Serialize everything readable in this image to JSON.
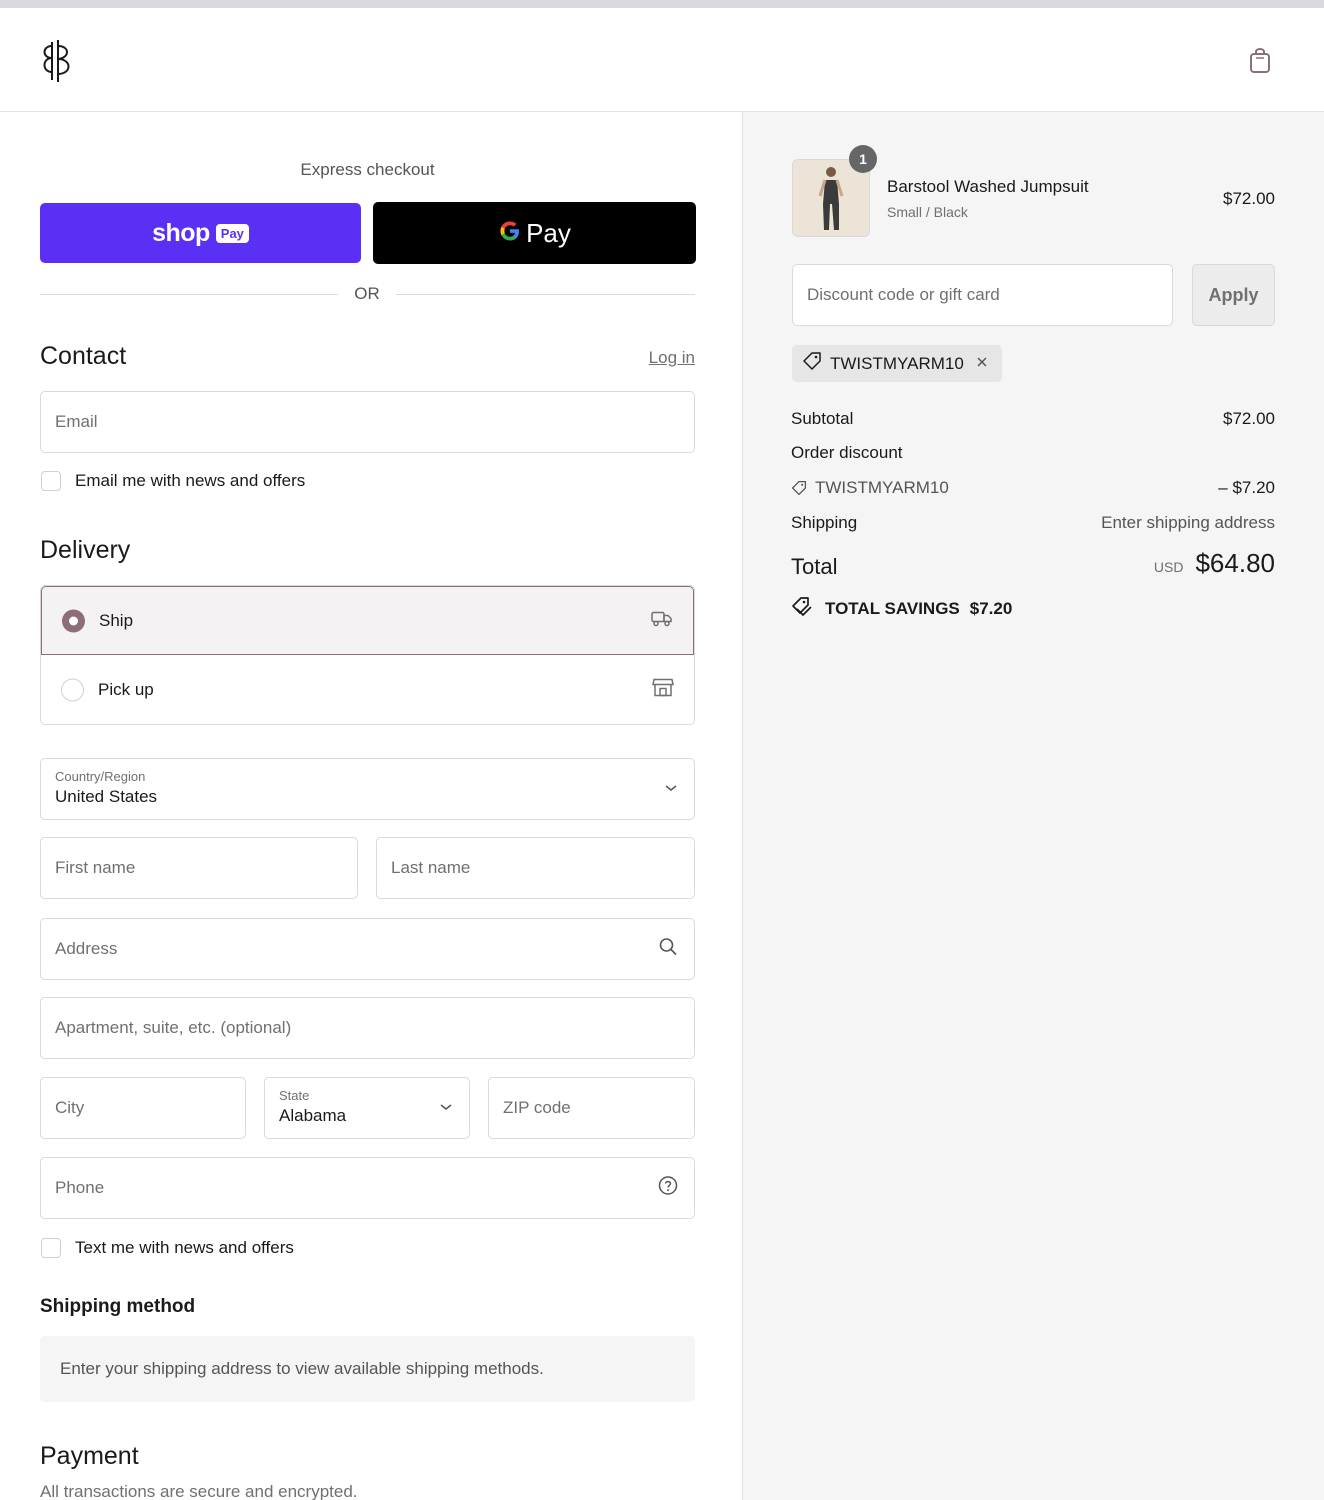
{
  "header": {
    "logo_icon": "brand-monogram-icon",
    "cart_icon": "shopping-bag-icon"
  },
  "express": {
    "label": "Express checkout",
    "shop_pay_word": "shop",
    "shop_pay_tag": "Pay",
    "gpay_word": "Pay",
    "or_text": "OR"
  },
  "contact": {
    "heading": "Contact",
    "login_label": "Log in",
    "email_placeholder": "Email",
    "news_label": "Email me with news and offers"
  },
  "delivery": {
    "heading": "Delivery",
    "options": [
      {
        "label": "Ship",
        "selected": true,
        "icon": "truck-icon"
      },
      {
        "label": "Pick up",
        "selected": false,
        "icon": "store-icon"
      }
    ],
    "country_label": "Country/Region",
    "country_value": "United States",
    "first_name_placeholder": "First name",
    "last_name_placeholder": "Last name",
    "address_placeholder": "Address",
    "apartment_placeholder": "Apartment, suite, etc. (optional)",
    "city_placeholder": "City",
    "state_label": "State",
    "state_value": "Alabama",
    "zip_placeholder": "ZIP code",
    "phone_placeholder": "Phone",
    "text_news_label": "Text me with news and offers"
  },
  "shipping_method": {
    "heading": "Shipping method",
    "note": "Enter your shipping address to view available shipping methods."
  },
  "payment": {
    "heading": "Payment",
    "subtext": "All transactions are secure and encrypted."
  },
  "summary": {
    "item": {
      "quantity": "1",
      "name": "Barstool Washed Jumpsuit",
      "variant": "Small / Black",
      "price": "$72.00"
    },
    "discount_placeholder": "Discount code or gift card",
    "apply_label": "Apply",
    "applied_code": "TWISTMYARM10",
    "subtotal_label": "Subtotal",
    "subtotal_value": "$72.00",
    "order_discount_label": "Order discount",
    "discount_code_line": "TWISTMYARM10",
    "discount_value": "– $7.20",
    "shipping_label": "Shipping",
    "shipping_value": "Enter shipping address",
    "total_label": "Total",
    "currency": "USD",
    "total_value": "$64.80",
    "savings_label": "TOTAL SAVINGS",
    "savings_value": "$7.20"
  },
  "colors": {
    "shop_pay": "#5a31f4",
    "accent": "#8d6e76",
    "panel_bg": "#f5f5f5"
  }
}
